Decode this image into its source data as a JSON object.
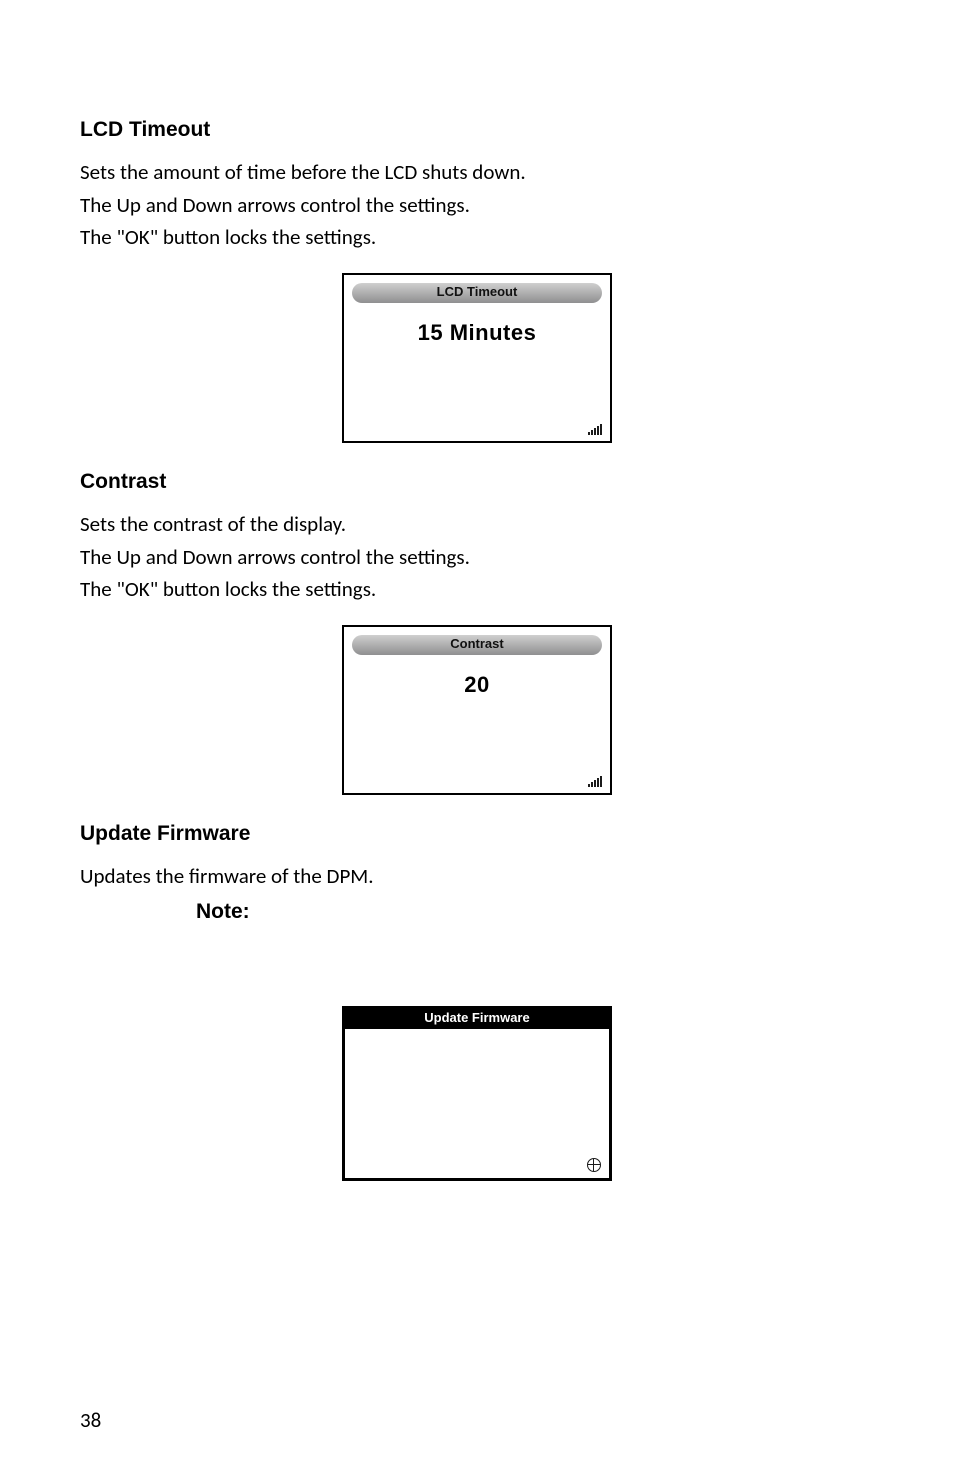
{
  "sections": {
    "lcd_timeout": {
      "heading": "LCD Timeout",
      "p1": "Sets the amount of time before the LCD shuts down.",
      "p2": "The Up and Down arrows control the settings.",
      "p3": "The \"OK\" button locks the settings.",
      "screen_title": "LCD Timeout",
      "screen_value": "15 Minutes"
    },
    "contrast": {
      "heading": "Contrast",
      "p1": "Sets the contrast of the display.",
      "p2": "The Up and Down arrows control the settings.",
      "p3": "The \"OK\" button locks the settings.",
      "screen_title": "Contrast",
      "screen_value": "20"
    },
    "update_firmware": {
      "heading": "Update Firmware",
      "p1": "Updates the firmware of the DPM.",
      "note_label": "Note:",
      "screen_title": "Update Firmware"
    }
  },
  "page_number": "38"
}
